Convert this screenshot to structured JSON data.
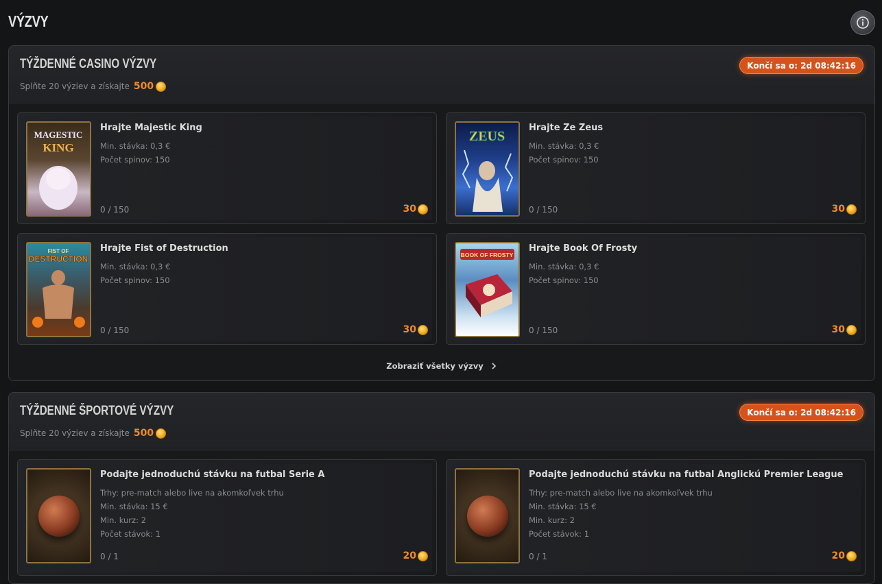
{
  "page": {
    "title": "VÝZVY",
    "info_icon": "info-icon"
  },
  "colors": {
    "accent": "#f08a2c",
    "timer_bg": "#d5531b",
    "card_border_gold": "#8d7440"
  },
  "casino": {
    "title": "TÝŽDENNÉ CASINO VÝZVY",
    "subtitle": "Splňte 20 výziev a získajte",
    "reward": "500",
    "timer": "Končí sa o: 2d 08:42:16",
    "see_all": "Zobraziť všetky výzvy",
    "cards": [
      {
        "title": "Hrajte Majestic King",
        "line1": "Min. stávka: 0,3 €",
        "line2": "Počet spinov: 150",
        "progress": "0 / 150",
        "reward": "30",
        "thumb_text": "MAGESTIC\nKING"
      },
      {
        "title": "Hrajte Ze Zeus",
        "line1": "Min. stávka: 0,3 €",
        "line2": "Počet spinov: 150",
        "progress": "0 / 150",
        "reward": "30",
        "thumb_text": "ZEUS"
      },
      {
        "title": "Hrajte Fist of Destruction",
        "line1": "Min. stávka: 0,3 €",
        "line2": "Počet spinov: 150",
        "progress": "0 / 150",
        "reward": "30",
        "thumb_text": "FIST OF\nDESTRUCTION"
      },
      {
        "title": "Hrajte Book Of Frosty",
        "line1": "Min. stávka: 0,3 €",
        "line2": "Počet spinov: 150",
        "progress": "0 / 150",
        "reward": "30",
        "thumb_text": "BOOK OF FROSTY"
      }
    ]
  },
  "sport": {
    "title": "TÝŽDENNÉ ŠPORTOVÉ VÝZVY",
    "subtitle": "Splňte 20 výziev a získajte",
    "reward": "500",
    "timer": "Končí sa o: 2d 08:42:16",
    "cards": [
      {
        "title": "Podajte jednoduchú stávku na futbal Serie A",
        "line1": "Trhy: pre-match alebo live na akomkoľvek trhu",
        "line2": "Min. stávka: 15 €",
        "line3": "Min. kurz: 2",
        "line4": "Počet stávok: 1",
        "progress": "0 / 1",
        "reward": "20"
      },
      {
        "title": "Podajte jednoduchú stávku na futbal Anglickú Premier League",
        "line1": "Trhy: pre-match alebo live na akomkoľvek trhu",
        "line2": "Min. stávka: 15 €",
        "line3": "Min. kurz: 2",
        "line4": "Počet stávok: 1",
        "progress": "0 / 1",
        "reward": "20"
      }
    ]
  }
}
